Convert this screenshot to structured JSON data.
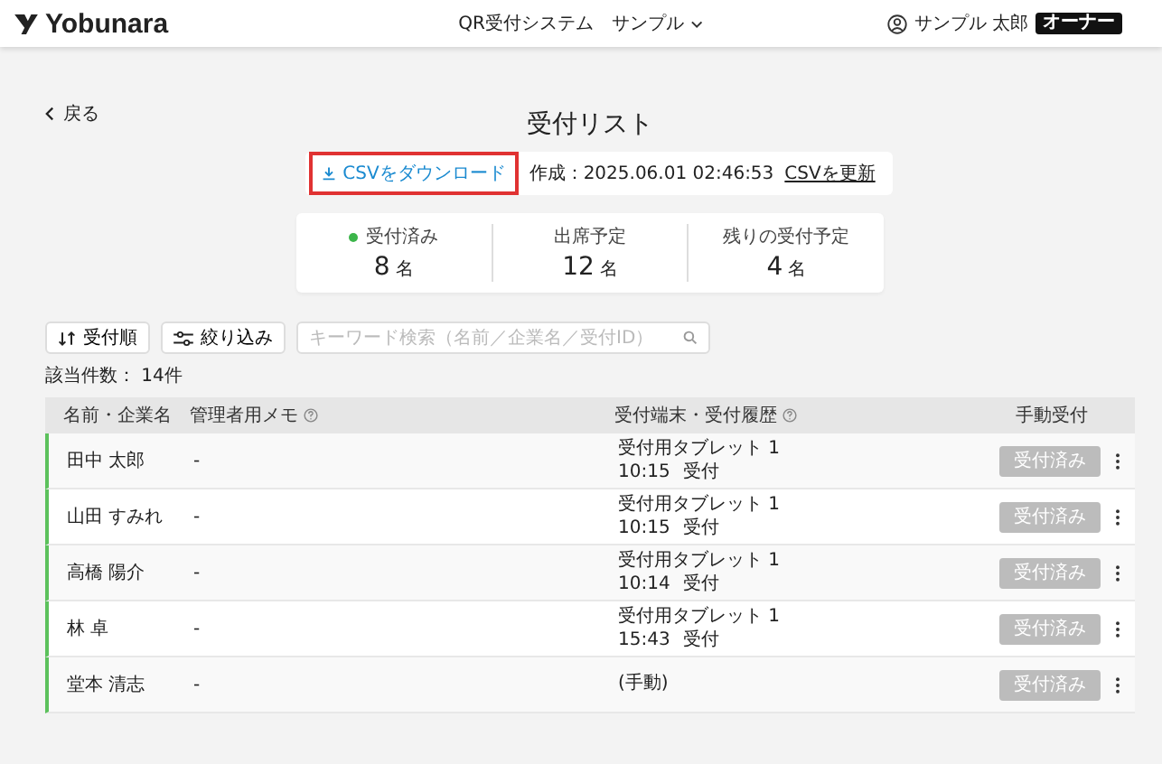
{
  "header": {
    "logo": "Yobunara",
    "nav": [
      {
        "label": "QR受付システム",
        "dropdown": false
      },
      {
        "label": "サンプル",
        "dropdown": true
      }
    ],
    "user": "サンプル 太郎",
    "role_badge": "オーナー"
  },
  "back_link": "戻る",
  "title": "受付リスト",
  "csv": {
    "download": "CSVをダウンロード",
    "created": "作成：2025.06.01 02:46:53",
    "refresh": "CSVを更新"
  },
  "stats": [
    {
      "label": "受付済み",
      "value": "8",
      "unit": "名",
      "dot": true
    },
    {
      "label": "出席予定",
      "value": "12",
      "unit": "名",
      "dot": false
    },
    {
      "label": "残りの受付予定",
      "value": "4",
      "unit": "名",
      "dot": false
    }
  ],
  "toolbar": {
    "sort": "受付順",
    "filter": "絞り込み",
    "search": {
      "placeholder": "キーワード検索（名前／企業名／受付ID）"
    }
  },
  "count": "該当件数： 14件",
  "table": {
    "columns": [
      {
        "label": "名前・企業名",
        "help": false
      },
      {
        "label": "管理者用メモ",
        "help": true
      },
      {
        "label": "受付端末・受付履歴",
        "help": true
      },
      {
        "label": "手動受付",
        "help": false
      }
    ],
    "rows": [
      {
        "name": "田中 太郎",
        "memo": "-",
        "device": "受付用タブレット 1",
        "time": "10:15",
        "action": "受付",
        "button": "受付済み",
        "received": true
      },
      {
        "name": "山田 すみれ",
        "memo": "-",
        "device": "受付用タブレット 1",
        "time": "10:15",
        "action": "受付",
        "button": "受付済み",
        "received": true
      },
      {
        "name": "高橋 陽介",
        "memo": "-",
        "device": "受付用タブレット 1",
        "time": "10:14",
        "action": "受付",
        "button": "受付済み",
        "received": true
      },
      {
        "name": "林 卓",
        "memo": "-",
        "device": "受付用タブレット 1",
        "time": "15:43",
        "action": "受付",
        "button": "受付済み",
        "received": true
      },
      {
        "name": "堂本 清志",
        "memo": "-",
        "device": "(手動)",
        "button": "受付済み",
        "received": true
      }
    ]
  }
}
